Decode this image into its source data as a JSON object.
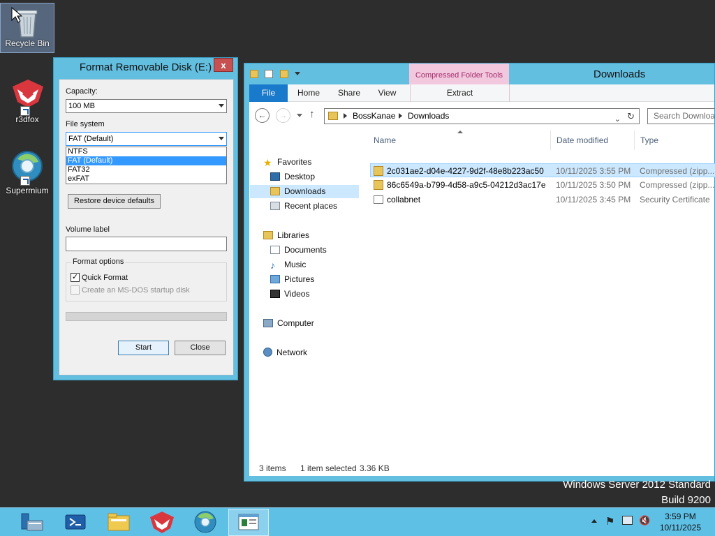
{
  "desktop": {
    "icons": [
      {
        "label": "Recycle Bin",
        "icon": "recycle-bin-icon"
      },
      {
        "label": "r3dfox",
        "icon": "r3dfox-icon"
      },
      {
        "label": "Supermium",
        "icon": "supermium-icon"
      }
    ],
    "watermark": {
      "line1": "Windows Server 2012 Standard",
      "line2": "Build 9200"
    }
  },
  "format_dialog": {
    "title": "Format Removable Disk (E:)",
    "close_label": "x",
    "capacity_label": "Capacity:",
    "capacity_value": "100 MB",
    "filesystem_label": "File system",
    "filesystem_value": "FAT (Default)",
    "filesystem_options": [
      "NTFS",
      "FAT (Default)",
      "FAT32",
      "exFAT"
    ],
    "filesystem_highlighted": "FAT (Default)",
    "restore_defaults_label": "Restore device defaults",
    "volume_label_label": "Volume label",
    "volume_label_value": "",
    "format_options_label": "Format options",
    "quick_format_label": "Quick Format",
    "quick_format_checked": true,
    "msdos_label": "Create an MS-DOS startup disk",
    "msdos_checked": false,
    "progress": 0,
    "start_label": "Start",
    "close_button_label": "Close"
  },
  "explorer": {
    "title": "Downloads",
    "contextual_tab_group": "Compressed Folder Tools",
    "ribbon_tabs": [
      "File",
      "Home",
      "Share",
      "View"
    ],
    "contextual_tab": "Extract",
    "breadcrumb": [
      "BossKanae",
      "Downloads"
    ],
    "search_placeholder": "Search Downloads",
    "nav": {
      "favorites_label": "Favorites",
      "favorites": [
        "Desktop",
        "Downloads",
        "Recent places"
      ],
      "libraries_label": "Libraries",
      "libraries": [
        "Documents",
        "Music",
        "Pictures",
        "Videos"
      ],
      "computer_label": "Computer",
      "network_label": "Network",
      "selected": "Downloads"
    },
    "columns": [
      "Name",
      "Date modified",
      "Type"
    ],
    "files": [
      {
        "name": "2c031ae2-d04e-4227-9d2f-48e8b223ac50",
        "date": "10/11/2025 3:55 PM",
        "type": "Compressed (zipp...",
        "icon": "zip-folder-icon",
        "selected": true
      },
      {
        "name": "86c6549a-b799-4d58-a9c5-04212d3ac17e",
        "date": "10/11/2025 3:50 PM",
        "type": "Compressed (zipp...",
        "icon": "zip-folder-icon",
        "selected": false
      },
      {
        "name": "collabnet",
        "date": "10/11/2025 3:45 PM",
        "type": "Security Certificate",
        "icon": "certificate-icon",
        "selected": false
      }
    ],
    "status": {
      "items": "3 items",
      "selected": "1 item selected",
      "size": "3.36 KB"
    }
  },
  "taskbar": {
    "buttons": [
      "server-manager-icon",
      "powershell-icon",
      "file-explorer-icon",
      "r3dfox-icon",
      "supermium-icon",
      "format-disk-icon"
    ],
    "time": "3:59 PM",
    "date": "10/11/2025"
  },
  "colors": {
    "accent": "#5fc0e6",
    "window_frame": "#63bfe0",
    "selection": "#cce8ff",
    "file_tab": "#1979ca",
    "contextual": "#f2c8de"
  }
}
